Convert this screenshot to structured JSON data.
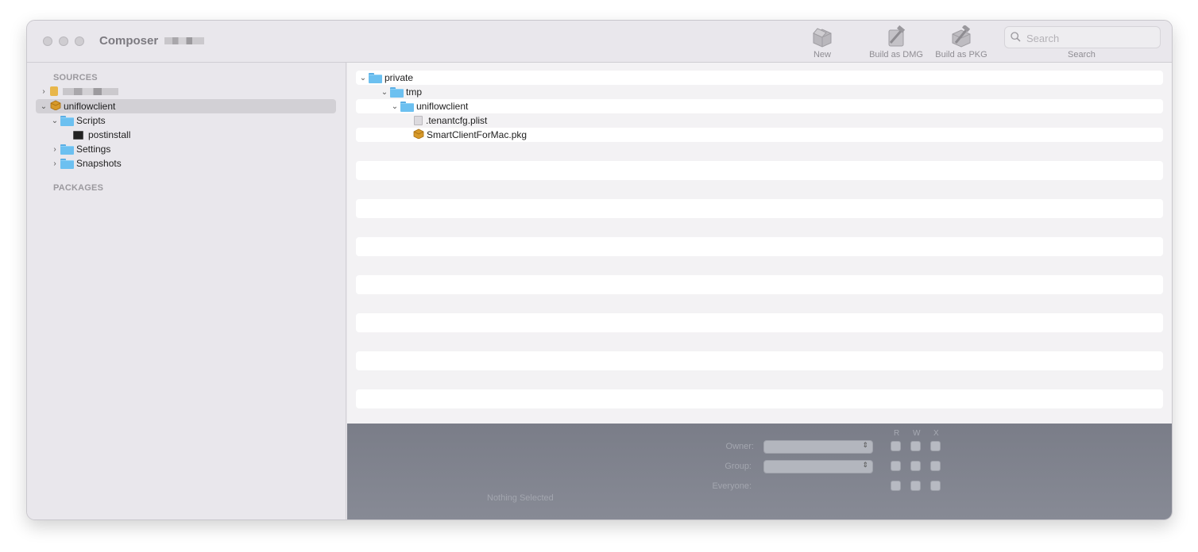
{
  "window": {
    "title": "Composer"
  },
  "toolbar": {
    "new_label": "New",
    "build_dmg_label": "Build as DMG",
    "build_pkg_label": "Build as PKG",
    "search_placeholder": "Search",
    "search_label": "Search"
  },
  "sidebar": {
    "sources_heading": "SOURCES",
    "packages_heading": "PACKAGES",
    "package_name": "uniflowclient",
    "scripts_label": "Scripts",
    "postinstall_label": "postinstall",
    "settings_label": "Settings",
    "snapshots_label": "Snapshots"
  },
  "files": {
    "private": "private",
    "tmp": "tmp",
    "uniflowclient": "uniflowclient",
    "plist": ".tenantcfg.plist",
    "pkg": "SmartClientForMac.pkg"
  },
  "permissions": {
    "r": "R",
    "w": "W",
    "x": "X",
    "owner_label": "Owner:",
    "group_label": "Group:",
    "everyone_label": "Everyone:",
    "status": "Nothing Selected"
  },
  "colors": {
    "folder": "#6cc0f0",
    "selection": "#d2d0d5",
    "permissions_bg": "#7a7d88"
  }
}
